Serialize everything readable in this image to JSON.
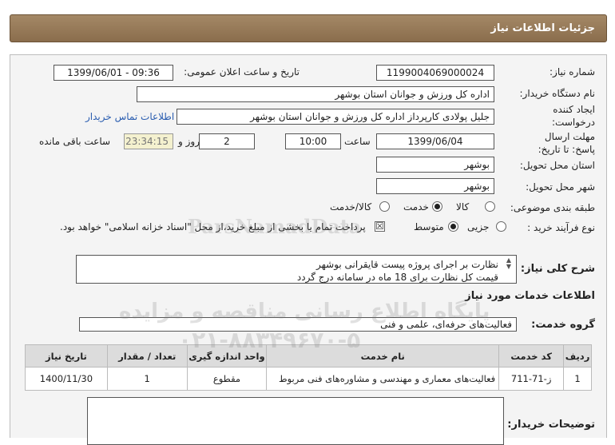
{
  "header": {
    "title": "جزئیات اطلاعات نیاز"
  },
  "need_number": {
    "label": "شماره نیاز:",
    "value": "1199004069000024"
  },
  "announce": {
    "label": "تاریخ و ساعت اعلان عمومی:",
    "value": "1399/06/01 - 09:36"
  },
  "buyer_org": {
    "label": "نام دستگاه خریدار:",
    "value": "اداره کل ورزش و جوانان استان بوشهر"
  },
  "creator": {
    "label": "ایجاد کننده درخواست:",
    "value": "جلیل پولادی کارپرداز اداره کل ورزش و جوانان استان بوشهر",
    "contact_link": "اطلاعات تماس خریدار"
  },
  "deadline": {
    "label": "مهلت ارسال پاسخ: تا تاریخ:",
    "date": "1399/06/04",
    "time_label": "ساعت",
    "time": "10:00",
    "days": "2",
    "days_label": "روز و",
    "remaining": "23:34:15",
    "remaining_label": "ساعت باقی مانده"
  },
  "province": {
    "label": "استان محل تحویل:",
    "value": "بوشهر"
  },
  "city": {
    "label": "شهر محل تحویل:",
    "value": "بوشهر"
  },
  "category": {
    "label": "طبقه بندی موضوعی:",
    "options": [
      "کالا",
      "خدمت",
      "کالا/خدمت"
    ],
    "selected": "خدمت"
  },
  "process": {
    "label": "نوع فرآیند خرید :",
    "options": [
      "جزیی",
      "متوسط"
    ],
    "selected": "متوسط",
    "checkbox_text": "پرداخت تمام یا بخشی از مبلغ خرید،از محل \"اسناد خزانه اسلامی\" خواهد بود."
  },
  "summary": {
    "label": "شرح کلی نیاز:",
    "line1": "نظارت بر اجرای پروژه پیست قایقرانی بوشهر",
    "line2": "قیمت کل نظارت برای 18 ماه در سامانه درج گردد"
  },
  "services_title": "اطلاعات خدمات مورد نیاز",
  "service_group": {
    "label": "گروه خدمت:",
    "value": "فعالیت‌های حرفه‌ای، علمی و فنی"
  },
  "table": {
    "headers": [
      "ردیف",
      "کد خدمت",
      "نام خدمت",
      "واحد اندازه گیری",
      "تعداد / مقدار",
      "تاریخ نیاز"
    ],
    "rows": [
      [
        "1",
        "ز-71-711",
        "فعالیت‌های معماری و مهندسی و مشاوره‌های فنی مربوط",
        "مقطوع",
        "1",
        "1400/11/30"
      ]
    ]
  },
  "buyer_notes": {
    "label": "توضیحات خریدار:"
  },
  "watermark": {
    "brand": "ParsNamadData",
    "line1": "پایگاه اطلاع رسانی مناقصه و مزایده",
    "line2": "۰۲۱-۸۸۳۴۹۶۷۰-۵"
  }
}
